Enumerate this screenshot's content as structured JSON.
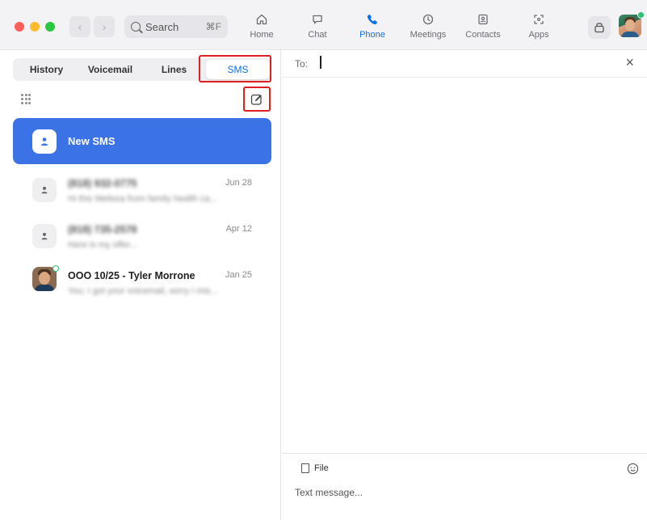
{
  "search": {
    "label": "Search",
    "shortcut": "⌘F"
  },
  "tabs": [
    {
      "label": "Home",
      "icon": "home-icon"
    },
    {
      "label": "Chat",
      "icon": "chat-icon"
    },
    {
      "label": "Phone",
      "icon": "phone-icon",
      "active": true
    },
    {
      "label": "Meetings",
      "icon": "clock-icon"
    },
    {
      "label": "Contacts",
      "icon": "contacts-icon"
    },
    {
      "label": "Apps",
      "icon": "apps-icon"
    }
  ],
  "segments": [
    {
      "label": "History"
    },
    {
      "label": "Voicemail"
    },
    {
      "label": "Lines"
    },
    {
      "label": "SMS",
      "active": true
    }
  ],
  "new_sms": {
    "label": "New SMS"
  },
  "conversations": [
    {
      "name": "(818) 932-0775",
      "preview": "Hi this Melissa from family health ca...",
      "date": "Jun 28",
      "blurred": true
    },
    {
      "name": "(818) 735-2578",
      "preview": "Here is my offer...",
      "date": "Apr 12",
      "blurred": true
    },
    {
      "name": "OOO 10/25 - Tyler Morrone",
      "preview": "You: I got your voicemail, sorry I mis...",
      "date": "Jan 25",
      "blurred_preview": true
    }
  ],
  "composer": {
    "to_label": "To:",
    "file_label": "File",
    "message_placeholder": "Text message..."
  },
  "colors": {
    "accent": "#0e71eb",
    "new_sms_bg": "#3b73e6",
    "highlight_box": "#e02020",
    "online": "#2fbf71"
  }
}
